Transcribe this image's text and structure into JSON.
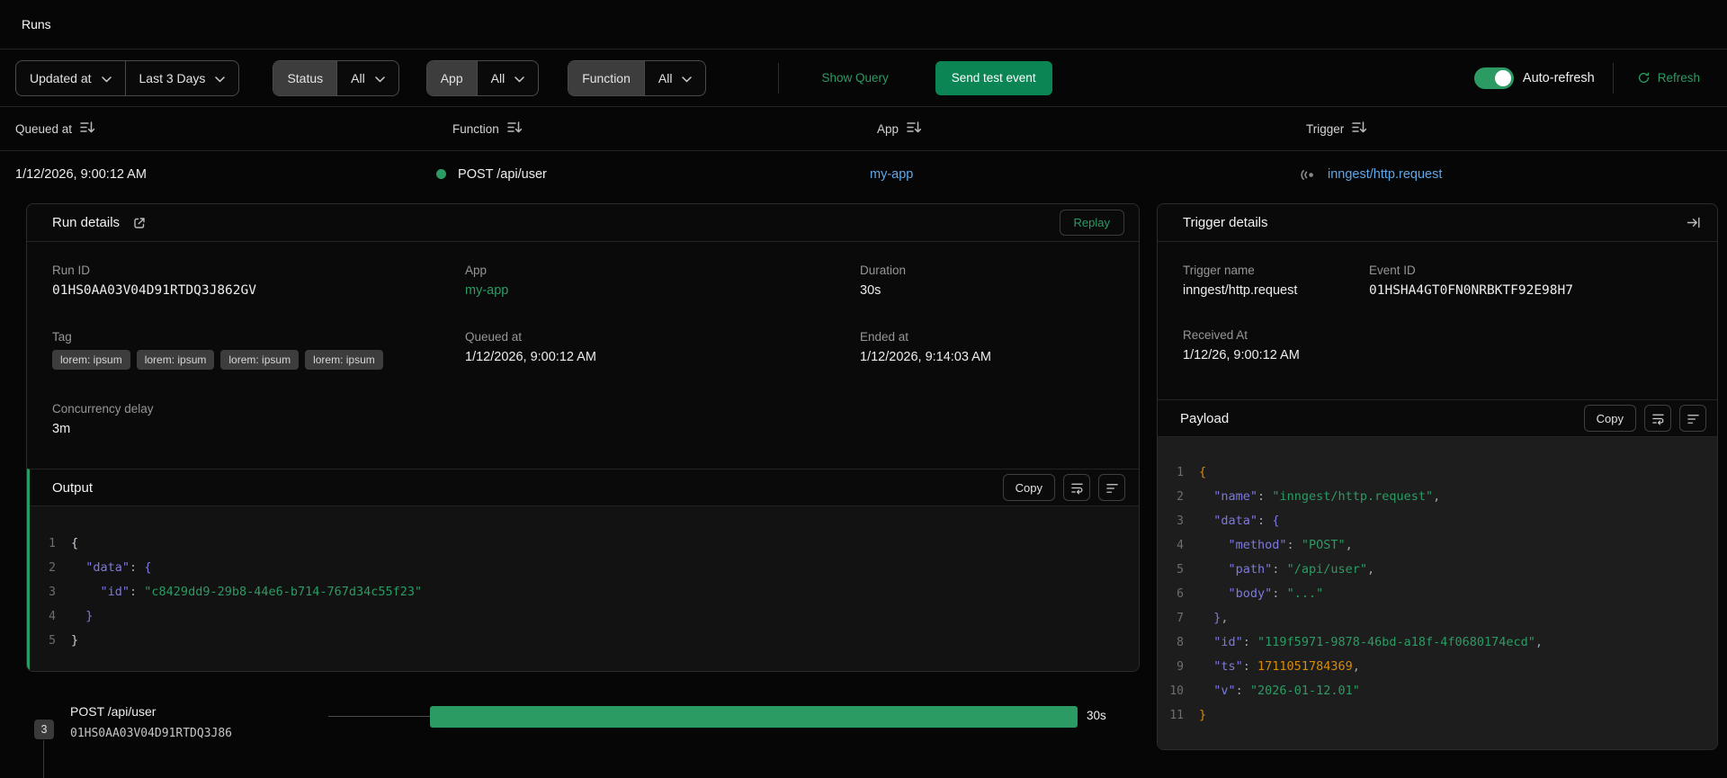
{
  "page": {
    "title": "Runs"
  },
  "colors": {
    "accent_green": "#2c9b63",
    "button_green": "#0b8554",
    "link_blue": "#5ea7e8",
    "code_key": "#7d79e0",
    "code_string": "#2c9b63",
    "code_number": "#d78b09",
    "code_punct": "#9aa4ae"
  },
  "toolbar": {
    "sort_field": {
      "label": "Updated at"
    },
    "time_range": {
      "label": "Last 3 Days"
    },
    "filters": [
      {
        "label": "Status",
        "value": "All"
      },
      {
        "label": "App",
        "value": "All"
      },
      {
        "label": "Function",
        "value": "All"
      }
    ],
    "show_query_label": "Show Query",
    "send_test_event_label": "Send test event",
    "auto_refresh_label": "Auto-refresh",
    "auto_refresh_on": true,
    "refresh_label": "Refresh"
  },
  "table": {
    "columns": [
      "Queued at",
      "Function",
      "App",
      "Trigger"
    ],
    "row": {
      "queued_at": "1/12/2026, 9:00:12 AM",
      "function": "POST /api/user",
      "status": "completed",
      "app": "my-app",
      "trigger": "inngest/http.request"
    }
  },
  "run_details": {
    "title": "Run details",
    "replay_label": "Replay",
    "fields": {
      "run_id_label": "Run ID",
      "run_id": "01HS0AA03V04D91RTDQ3J862GV",
      "app_label": "App",
      "app": "my-app",
      "duration_label": "Duration",
      "duration": "30s",
      "tag_label": "Tag",
      "tags": [
        "lorem: ipsum",
        "lorem: ipsum",
        "lorem: ipsum",
        "lorem: ipsum"
      ],
      "queued_at_label": "Queued at",
      "queued_at": "1/12/2026, 9:00:12 AM",
      "ended_at_label": "Ended at",
      "ended_at": "1/12/2026, 9:14:03 AM",
      "concurrency_delay_label": "Concurrency delay",
      "concurrency_delay": "3m"
    },
    "output": {
      "title": "Output",
      "copy_label": "Copy",
      "code_lines": [
        "{",
        "  \"data\": {",
        "    \"id\": \"c8429dd9-29b8-44e6-b714-767d34c55f23\"",
        "  }",
        "}"
      ],
      "brace_palette": [
        "#c9d1d9",
        "#7d79e0",
        "#7d79e0"
      ]
    }
  },
  "trigger_details": {
    "title": "Trigger details",
    "fields": {
      "trigger_name_label": "Trigger name",
      "trigger_name": "inngest/http.request",
      "event_id_label": "Event ID",
      "event_id": "01HSHA4GT0FN0NRBKTF92E98H7",
      "received_at_label": "Received At",
      "received_at": "1/12/26, 9:00:12 AM"
    },
    "payload": {
      "title": "Payload",
      "copy_label": "Copy",
      "code_lines": [
        "{",
        "  \"name\": \"inngest/http.request\",",
        "  \"data\": {",
        "    \"method\": \"POST\",",
        "    \"path\": \"/api/user\",",
        "    \"body\": \"...\"",
        "  },",
        "  \"id\": \"119f5971-9878-46bd-a18f-4f0680174ecd\",",
        "  \"ts\": 1711051784369,",
        "  \"v\": \"2026-01-12.01\"",
        "}"
      ],
      "brace_palette": [
        "#d78b09",
        "#7d79e0",
        "#7d79e0"
      ]
    }
  },
  "timeline": {
    "step_count": "3",
    "step_name": "POST /api/user",
    "run_id_short": "01HS0AA03V04D91RTDQ3J86",
    "duration": "30s"
  }
}
